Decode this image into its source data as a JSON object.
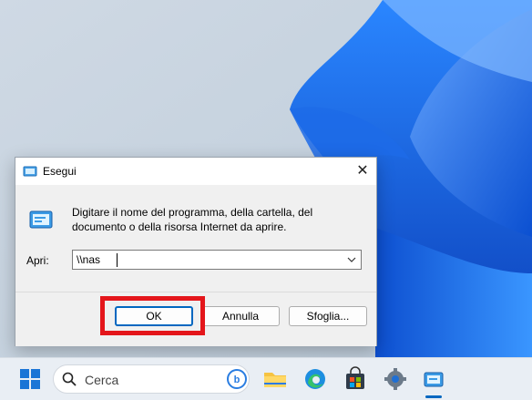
{
  "dialog": {
    "title": "Esegui",
    "description": "Digitare il nome del programma, della cartella, del documento o della risorsa Internet da aprire.",
    "open_label": "Apri:",
    "open_value": "\\\\nas",
    "ok_label": "OK",
    "cancel_label": "Annulla",
    "browse_label": "Sfoglia...",
    "close_symbol": "✕"
  },
  "taskbar": {
    "search_placeholder": "Cerca",
    "icons": [
      "windows-start-icon",
      "search-icon",
      "bing-icon",
      "file-explorer-icon",
      "edge-browser-icon",
      "microsoft-store-icon",
      "settings-icon",
      "run-app-icon"
    ]
  },
  "colors": {
    "highlight": "#e4161b",
    "accent": "#0067c0",
    "wallpaper_blue": "#1a6fe8"
  }
}
